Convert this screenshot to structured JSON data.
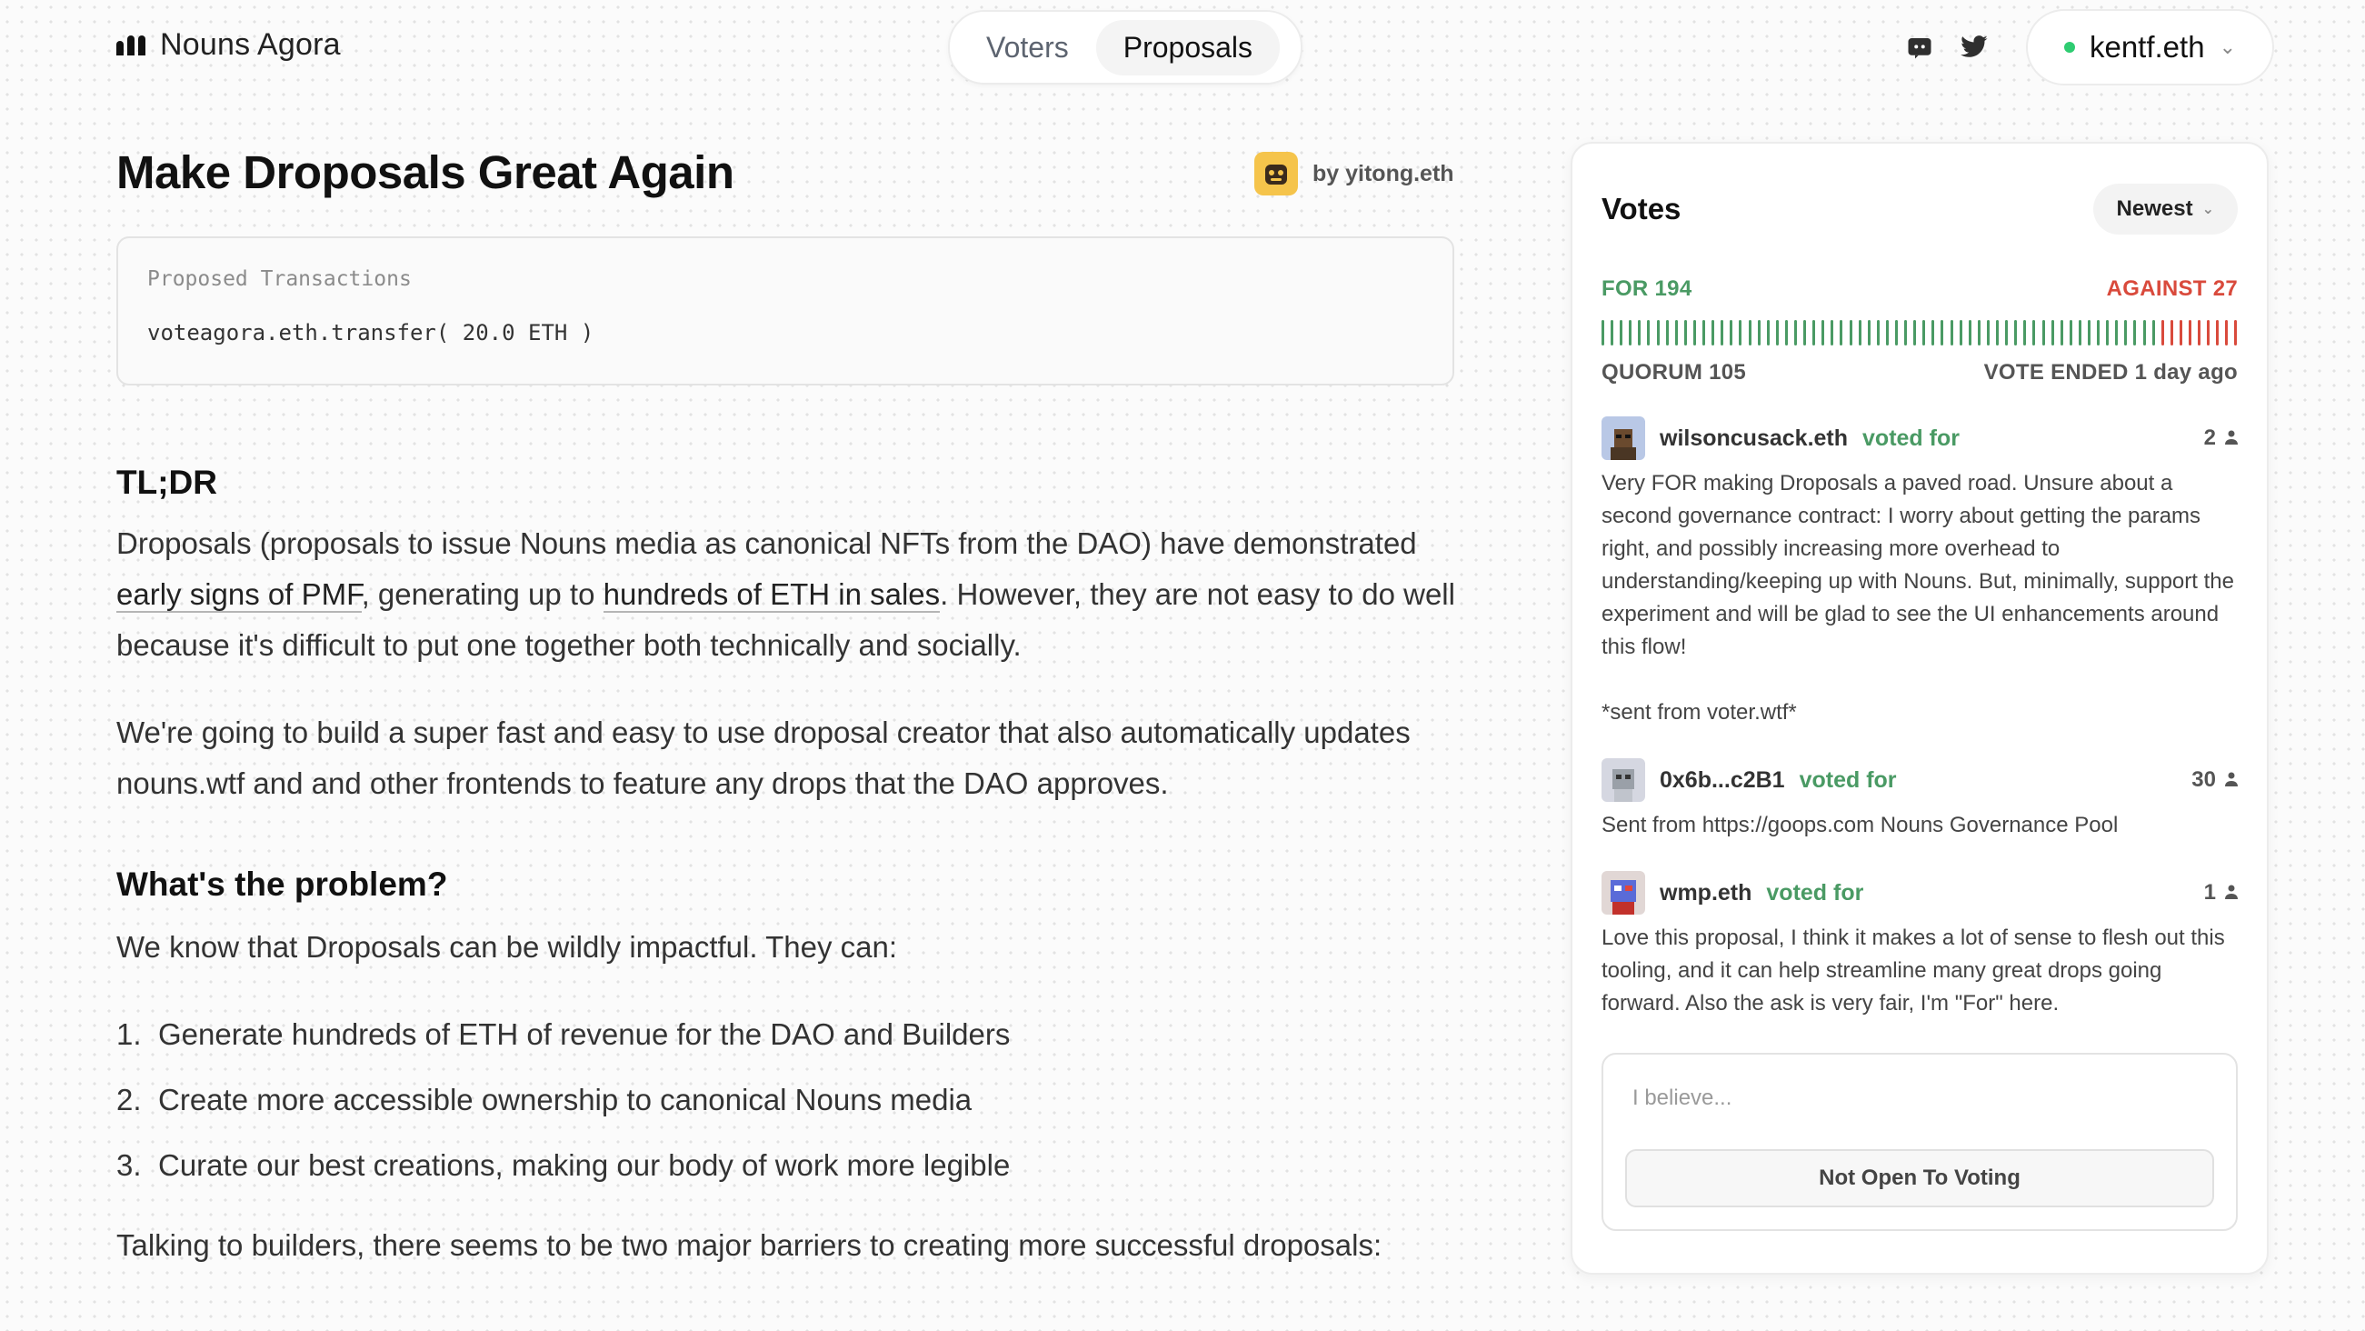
{
  "header": {
    "app_name": "Nouns Agora",
    "nav_tabs": [
      {
        "label": "Voters",
        "active": false
      },
      {
        "label": "Proposals",
        "active": true
      }
    ],
    "icons": [
      "discord-icon",
      "twitter-icon"
    ],
    "wallet": {
      "label": "kentf.eth",
      "status_color": "#2ecc71"
    }
  },
  "proposal": {
    "title": "Make Droposals Great Again",
    "author": "by yitong.eth",
    "transactions_label": "Proposed Transactions",
    "transaction_call": "voteagora.eth.transfer( 20.0 ETH )"
  },
  "content": {
    "tldr_heading": "TL;DR",
    "p1_part1": "Droposals (proposals to issue Nouns media as canonical NFTs from the DAO) have demonstrated ",
    "p1_link1": "early signs of PMF",
    "p1_part2": ", generating up to ",
    "p1_link2": "hundreds of ETH in sales",
    "p1_part3": ". However, they are not easy to do well because it's difficult to put one together both technically and socially.",
    "p2": "We're going to build a super fast and easy to use droposal creator that also automatically updates nouns.wtf and and other frontends to feature any drops that the DAO approves.",
    "problem_heading": "What's the problem?",
    "p3": "We know that Droposals can be wildly impactful. They can:",
    "list": [
      {
        "num": "1.",
        "text": "Generate hundreds of ETH of revenue for the DAO and Builders"
      },
      {
        "num": "2.",
        "text": "Create more accessible ownership to canonical Nouns media"
      },
      {
        "num": "3.",
        "text": "Curate our best creations, making our body of work more legible"
      }
    ],
    "p4": "Talking to builders, there seems to be two major barriers to creating more successful droposals:"
  },
  "votes": {
    "title": "Votes",
    "sort_label": "Newest",
    "for_label": "FOR 194",
    "against_label": "AGAINST 27",
    "for_count": 194,
    "against_count": 27,
    "for_color": "#4a9a64",
    "against_color": "#d94a3c",
    "quorum_label": "QUORUM 105",
    "status_label": "VOTE ENDED 1 day ago",
    "items": [
      {
        "name": "wilsoncusack.eth",
        "direction": "voted for",
        "weight": "2",
        "reason": "Very FOR making Droposals a paved road. Unsure about a second governance contract: I worry about getting the params right, and possibly increasing more overhead to understanding/keeping up with Nouns. But, minimally, support the experiment and will be glad to see the UI enhancements around this flow!\n\n*sent from voter.wtf*"
      },
      {
        "name": "0x6b...c2B1",
        "direction": "voted for",
        "weight": "30",
        "reason": "Sent from https://goops.com Nouns Governance Pool"
      },
      {
        "name": "wmp.eth",
        "direction": "voted for",
        "weight": "1",
        "reason": "Love this proposal, I think it makes a lot of sense to flesh out this tooling, and it can help streamline many great drops going forward. Also the ask is very fair, I'm \"For\" here."
      }
    ],
    "input_placeholder": "I believe...",
    "button_label": "Not Open To Voting"
  }
}
